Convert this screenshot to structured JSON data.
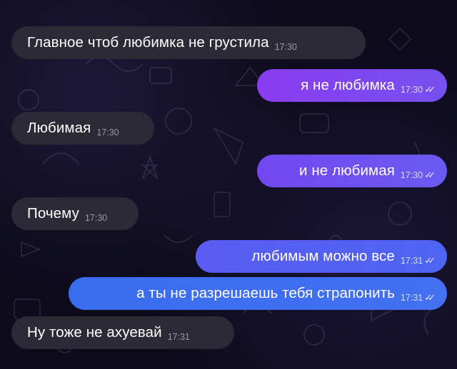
{
  "colors": {
    "background": "#0d0b1c",
    "incoming_bubble": "#2b2a35",
    "outgoing_gradient_purple": "#8a3cf0",
    "outgoing_gradient_blue": "#3a6cf0"
  },
  "messages": [
    {
      "direction": "incoming",
      "text": "Главное чтоб любимка не грустила",
      "time": "17:30"
    },
    {
      "direction": "outgoing",
      "text": "я не любимка",
      "time": "17:30",
      "status_icon": "double-check-icon"
    },
    {
      "direction": "incoming",
      "text": "Любимая",
      "time": "17:30"
    },
    {
      "direction": "outgoing",
      "text": "и не любимая",
      "time": "17:30",
      "status_icon": "double-check-icon"
    },
    {
      "direction": "incoming",
      "text": "Почему",
      "time": "17:30"
    },
    {
      "direction": "outgoing",
      "text": "любимым можно все",
      "time": "17:31",
      "status_icon": "double-check-icon"
    },
    {
      "direction": "outgoing",
      "text": "а ты не разрешаешь тебя страпонить",
      "time": "17:31",
      "status_icon": "double-check-icon"
    },
    {
      "direction": "incoming",
      "text": "Ну тоже не ахуевай",
      "time": "17:31"
    }
  ]
}
